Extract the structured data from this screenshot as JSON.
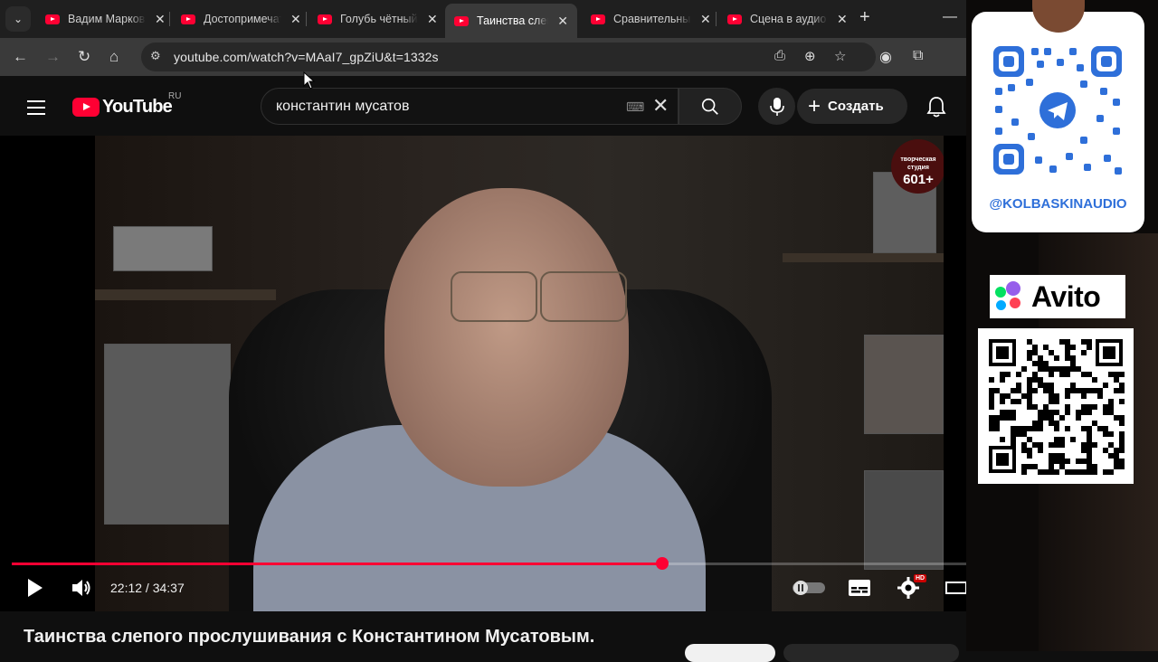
{
  "tabs": [
    {
      "title": "Вадим Маркович",
      "active": false
    },
    {
      "title": "Достопримечательности",
      "active": false
    },
    {
      "title": "Голубь чётный",
      "active": false
    },
    {
      "title": "Таинства слепого",
      "active": true
    },
    {
      "title": "Сравнительный",
      "active": false
    },
    {
      "title": "Сцена в аудио",
      "active": false
    }
  ],
  "address": {
    "url": "youtube.com/watch?v=MAaI7_gpZiU&t=1332s"
  },
  "youtube": {
    "logo_text": "YouTube",
    "region": "RU",
    "search_value": "константин мусатов",
    "create_label": "Создать"
  },
  "player": {
    "current_time": "22:12",
    "duration": "34:37",
    "time_display": "22:12 / 34:37",
    "progress": 0.641,
    "hd_badge": "HD",
    "studio_badge_line1": "творческая",
    "studio_badge_line2": "студия",
    "studio_badge_line3": "601+"
  },
  "video": {
    "title": "Таинства слепого прослушивания с Константином Мусатовым."
  },
  "overlay": {
    "telegram_handle": "@KOLBASKINAUDIO",
    "avito_label": "Avito"
  },
  "colors": {
    "accent": "#ff0033",
    "handle": "#2e6fd9"
  }
}
